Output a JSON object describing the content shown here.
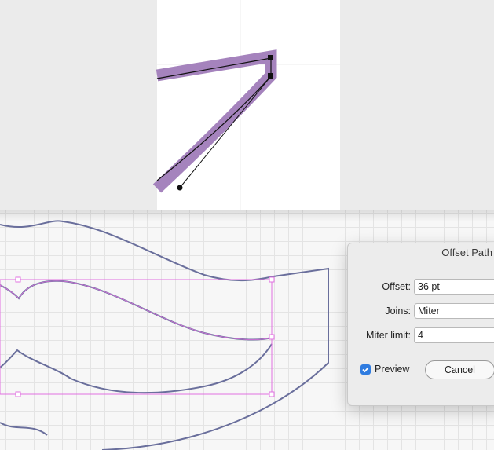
{
  "dialog": {
    "title": "Offset Path",
    "offset_label": "Offset:",
    "offset_value": "36 pt",
    "joins_label": "Joins:",
    "joins_value": "Miter",
    "miter_label": "Miter limit:",
    "miter_value": "4",
    "preview_label": "Preview",
    "preview_checked": true,
    "cancel_label": "Cancel"
  },
  "colors": {
    "offset_stroke": "#a583bd",
    "path_line": "#111111",
    "selection": "#e070e0",
    "shape_outline": "#6a6f9c",
    "accent": "#2f7ce0"
  }
}
